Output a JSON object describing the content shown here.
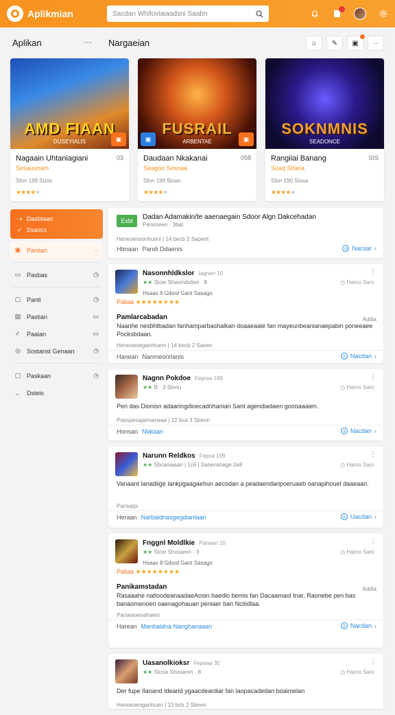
{
  "app": {
    "name": "Aplikmian"
  },
  "search": {
    "placeholder": "Sacdan Whifoviaiaadsni Saabn"
  },
  "sections": {
    "left_title": "Aplikan",
    "left_more": "···",
    "right_title": "Nargaeian"
  },
  "featured": [
    {
      "title": "Nagaain Uhtaniagiani",
      "count": "03",
      "subtitle": "Sesauunam",
      "meta": "Sfon 199  Siziis",
      "rating_stars": 4,
      "watermark": "AMD FIAAN",
      "watermark_sub": "DUSEYIALIS",
      "badge": "▣"
    },
    {
      "title": "Daudaan Nkakanai",
      "count": "058",
      "subtitle": "Seagoo Sesnaa",
      "meta": "Sfon 199  Sioan",
      "rating_stars": 4,
      "watermark": "FUSRAIL",
      "watermark_sub": "ARBENTAE",
      "badge": "▣"
    },
    {
      "title": "Rangiiai Banang",
      "count": "SIS",
      "subtitle": "Soaq Sifana",
      "meta": "Sfon 190  Siosa",
      "rating_stars": 4,
      "watermark": "SOKNMNIS",
      "watermark_sub": "SEADONCE",
      "badge": ""
    }
  ],
  "sidebar": {
    "active_items": [
      {
        "label": "Dasbtaan"
      },
      {
        "label": "Ssaocs"
      }
    ],
    "items": [
      {
        "label": "Paniian",
        "icon": "▣",
        "right": "··",
        "selected": true
      },
      {
        "label": "Pasbas",
        "icon": "▭",
        "right": "◷"
      },
      {
        "label": "Panti",
        "icon": "▢",
        "right": "◷"
      },
      {
        "label": "Pastian",
        "icon": "▤",
        "right": "▭"
      },
      {
        "label": "Paaian",
        "icon": "✓",
        "right": "▭"
      },
      {
        "label": "Sostanst Genaan",
        "icon": "◎",
        "right": "◷"
      },
      {
        "label": "Paskaan",
        "icon": "▢",
        "right": "◷"
      },
      {
        "label": "Dsteis",
        "icon": "←",
        "right": ""
      }
    ]
  },
  "feed": {
    "announcement": {
      "tag": "Exbl",
      "title": "Dadan Adamakin/te aaenaegain Sdoor Algn Dakcehadan",
      "sub": "Penooeeo  ·  3bat",
      "metrics": "Heneoensonhueni  |  14 becb 2 Sapent",
      "foot_label": "Hbnaan",
      "foot_link": "Pandi Ddaenis",
      "cta": "Nacsar"
    },
    "posts": [
      {
        "name": "Nasonnhldkslor",
        "time": "Iagnen 10",
        "line2": "Stcie Shwondstien",
        "line2_extra": "·  8",
        "follow": "Hamo Sani",
        "rating_label": "Paliaa",
        "has_detail": true,
        "detail_line": "Hsaas  8  Gibod  Gant  Sasago",
        "heading": "Pamlarcabadan",
        "adds": "Addia",
        "body": "Naanhe nesbhtbadan fanhamparbashalkan doaaeaale fan mayeunbeanianaepabin poneeaee Pocksbdaan.",
        "metrics": "Heneoeoegamhuem  |  14 becb 2 Saoen",
        "foot_label": "Hanean",
        "foot_link": "Nanmeonrlanis",
        "foot_link_color": "#555",
        "cta": "Nacdan",
        "thumb": "a"
      },
      {
        "name": "Nagnn Pokdoe",
        "time": "Fepraa 199",
        "line2": "B · 3 Slonn",
        "line2_extra": "",
        "follow": "Hamo Sani",
        "rating_label": "",
        "has_detail": false,
        "detail_line": "",
        "heading": "",
        "adds": "",
        "body": "Pen das Dionisn adaaringdioecadnhanian Sant agendiadaen goooaaaien.",
        "metrics": "Pepspesapemaneae  |  22 bca 3 Sbeon",
        "foot_label": "Honsan",
        "foot_link": "Nlataan",
        "foot_link_color": "#2a8bd8",
        "cta": "Nacdan",
        "thumb": "b"
      },
      {
        "name": "Narunn Reldkos",
        "time": "Fepsa 199",
        "line2": "Sbcaniaaan  |  1c6  |  Sanenshage",
        "line2_extra": "2e8",
        "follow": "Hamo Sani",
        "rating_label": "",
        "has_detail": false,
        "detail_line": "",
        "heading": "",
        "adds": "",
        "body": "Vanaant Ianadiige lankpgaagaehun aecodan a peadaendaripoeruaeb oanapihouel daaeaan.",
        "metrics": "Pansaqs",
        "foot_label": "Heraan",
        "foot_link": "Narbaldnasgegdianlaan",
        "foot_link_color": "#2a8bd8",
        "cta": "Uacdan",
        "thumb": "c"
      },
      {
        "name": "Fnggnl Moldlkie",
        "time": "Panaan 10",
        "line2": "Stcie Shosaren",
        "line2_extra": "·  3",
        "follow": "Hamo Sani",
        "rating_label": "Paliaa",
        "has_detail": true,
        "detail_line": "Hsaas  8  Gibod  Gant  Sasago",
        "heading": "Panikamstadan",
        "adds": "Addia",
        "body": "Rasaaahe natloodeanaadaeAosin baedlo bemis fan Dacaamaol tnar, Raonebe pen bas banaomenoen oaenagohauan peniaer ban Ncitidlaa.",
        "metrics": "Parseaoeoahaem",
        "foot_label": "Harean",
        "foot_link": "Manbaldna Nanghanaaan",
        "foot_link_color": "#2a8bd8",
        "cta": "Nacdan",
        "thumb": "d"
      },
      {
        "name": "Uasanolkioksr",
        "time": "Fepaaa 30",
        "line2": "Stcoa Shosaren",
        "line2_extra": "·  8",
        "follow": "Hamo Sani",
        "rating_label": "",
        "has_detail": false,
        "detail_line": "",
        "heading": "",
        "adds": "",
        "body": "Der fupe Ilanand Idearid ygaacdeardiar fan laopacadedan boaimelan",
        "metrics": "Henoeoeoganhuen  |  13 bcb 2 Sbeen",
        "foot_label": "",
        "foot_link": "",
        "foot_link_color": "#2a8bd8",
        "cta": "",
        "thumb": "e"
      }
    ]
  },
  "colors": {
    "accent": "#f7931e",
    "accent_dark": "#f7711e",
    "link": "#2a8bd8",
    "star": "#f5a623",
    "tag_green": "#4caf50"
  }
}
